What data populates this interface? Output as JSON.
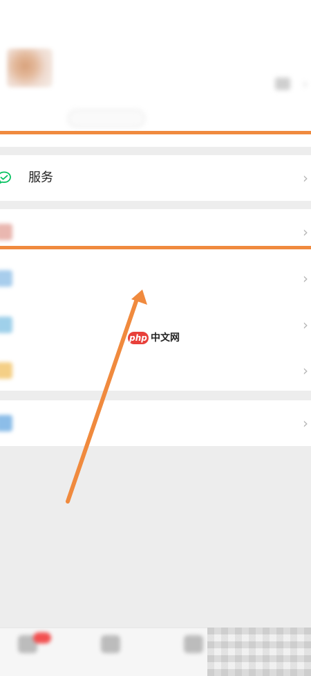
{
  "profile": {
    "name": "",
    "wechat_id": "",
    "status": ""
  },
  "menu": {
    "services": {
      "label": "服务",
      "icon": "wechat-pay-icon",
      "icon_color": "#07c160"
    },
    "favorites": {
      "label": "",
      "icon": "favorites-icon"
    },
    "moments": {
      "label": "",
      "icon": "moments-icon"
    },
    "channels": {
      "label": "",
      "icon": "channels-icon"
    },
    "cards": {
      "label": "",
      "icon": "cards-icon"
    },
    "settings": {
      "label": "",
      "icon": "settings-icon"
    }
  },
  "watermark": {
    "badge": "php",
    "text": "中文网"
  },
  "annotation": {
    "color": "#f08a3e"
  },
  "tabs": [
    {
      "label": "",
      "icon": "chats-icon"
    },
    {
      "label": "",
      "icon": "contacts-icon"
    },
    {
      "label": "",
      "icon": "discover-icon"
    },
    {
      "label": "",
      "icon": "me-icon"
    }
  ]
}
